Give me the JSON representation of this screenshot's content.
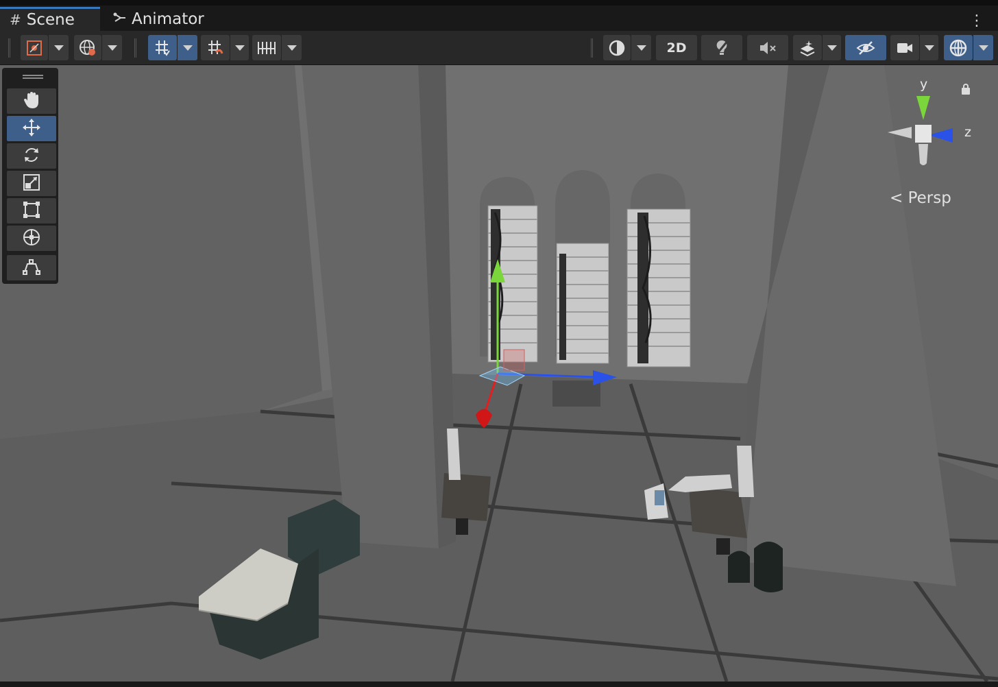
{
  "tabs": [
    {
      "label": "Scene",
      "icon": "hash-grid-icon",
      "active": true
    },
    {
      "label": "Animator",
      "icon": "animator-icon",
      "active": false
    }
  ],
  "toolbar": {
    "left_buttons": [
      "draw-mode-icon",
      "global-orientation-icon",
      "grid-snap-icon",
      "increment-snap-icon",
      "ruler-icon"
    ],
    "right_buttons": [
      "shading-mode-icon",
      "2d-toggle",
      "lighting-icon",
      "audio-mute-icon",
      "effects-icon",
      "scene-visibility-icon",
      "camera-icon",
      "gizmos-icon"
    ],
    "toggle_2d_label": "2D"
  },
  "tools": [
    "hand-tool",
    "move-tool",
    "rotate-tool",
    "scale-tool",
    "rect-tool",
    "transform-tool",
    "custom-editor-tool"
  ],
  "active_tool": "move-tool",
  "gizmo": {
    "y_label": "y",
    "z_label": "z",
    "projection_label": "Persp"
  },
  "colors": {
    "accent": "#3d5f8a",
    "tab_highlight": "#3a79bb",
    "axis_x": "#e02020",
    "axis_y": "#7ad63a",
    "axis_z": "#2b52e8"
  }
}
